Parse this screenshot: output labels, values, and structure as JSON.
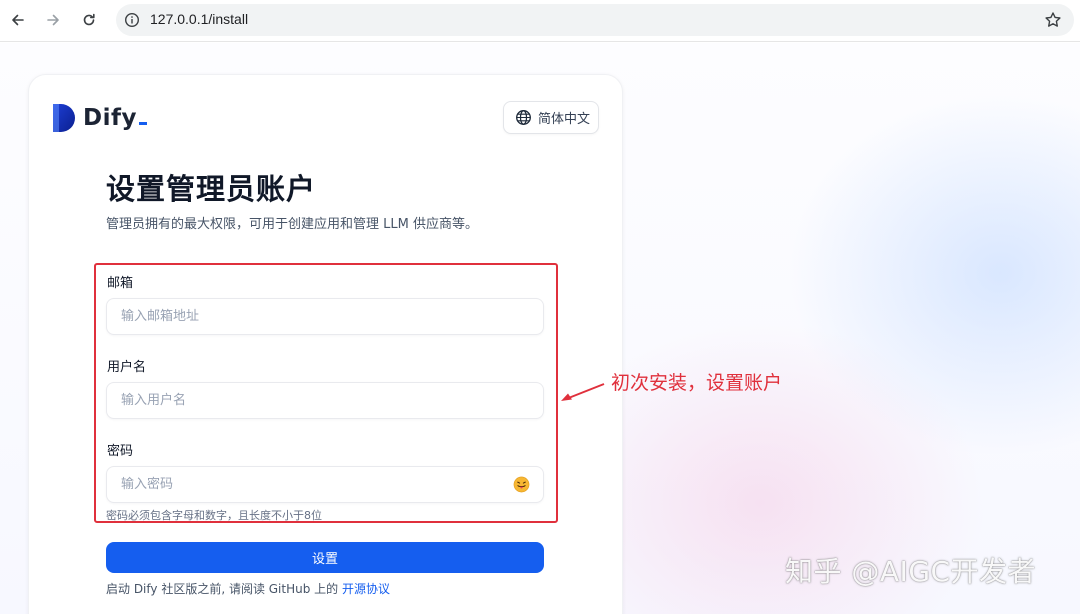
{
  "browser": {
    "url": "127.0.0.1/install",
    "icons": [
      "back-icon",
      "forward-icon",
      "reload-icon",
      "site-info-icon",
      "bookmark-star-icon"
    ]
  },
  "app": {
    "logo_text": "Dify",
    "language_label": "简体中文"
  },
  "form": {
    "title": "设置管理员账户",
    "subtitle": "管理员拥有的最大权限，可用于创建应用和管理 LLM 供应商等。",
    "email": {
      "label": "邮箱",
      "placeholder": "输入邮箱地址",
      "value": ""
    },
    "username": {
      "label": "用户名",
      "placeholder": "输入用户名",
      "value": ""
    },
    "password": {
      "label": "密码",
      "placeholder": "输入密码",
      "value": "",
      "hint": "密码必须包含字母和数字，且长度不小于8位"
    },
    "submit_label": "设置",
    "footer_prefix": "启动 Dify 社区版之前, 请阅读 GitHub 上的 ",
    "footer_link": "开源协议"
  },
  "annotation": {
    "text": "初次安装，设置账户",
    "color": "#e0303c"
  },
  "watermark": "知乎 @AIGC开发者",
  "colors": {
    "accent": "#155eef",
    "annotation_red": "#e0303c"
  }
}
